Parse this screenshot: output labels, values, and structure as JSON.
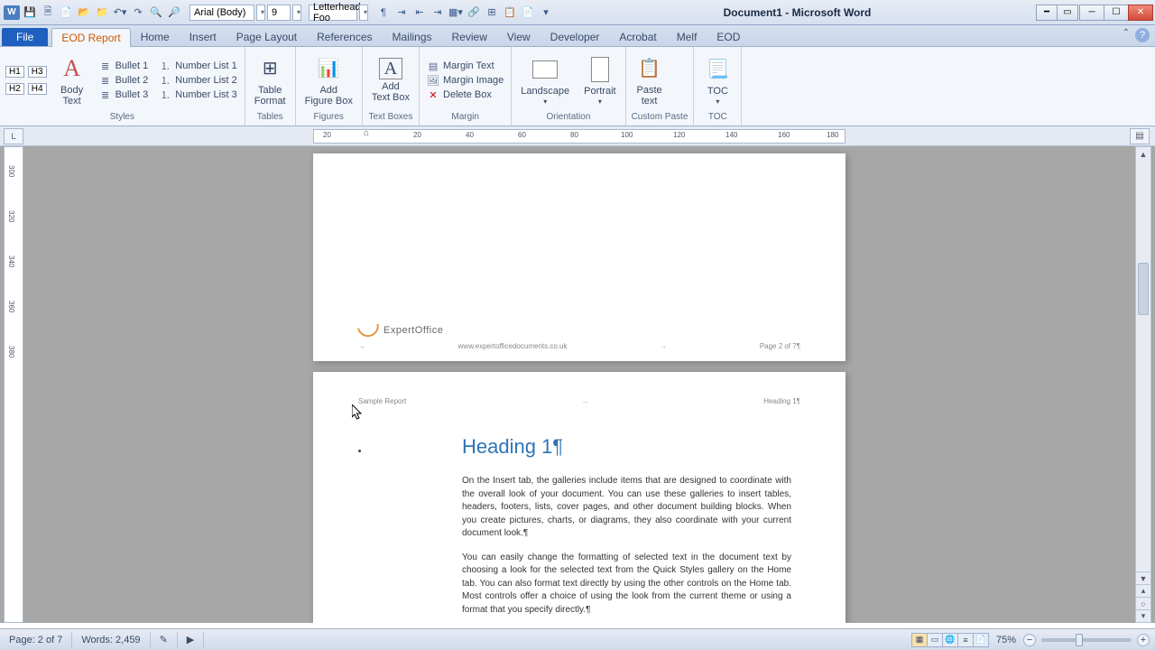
{
  "app": {
    "title": "Document1 - Microsoft Word"
  },
  "qat": {
    "font_name": "Arial (Body)",
    "font_size": "9",
    "quick_style": "Letterhead Foo"
  },
  "tabs": {
    "file": "File",
    "items": [
      "EOD Report",
      "Home",
      "Insert",
      "Page Layout",
      "References",
      "Mailings",
      "Review",
      "View",
      "Developer",
      "Acrobat",
      "Melf",
      "EOD"
    ],
    "active_index": 0
  },
  "ribbon": {
    "styles": {
      "label": "Styles",
      "h1": "H1",
      "h2": "H2",
      "h3": "H3",
      "h4": "H4",
      "body_text": "Body\nText",
      "bullets": [
        "Bullet 1",
        "Bullet 2",
        "Bullet 3"
      ],
      "numbers": [
        "Number List 1",
        "Number List 2",
        "Number List 3"
      ]
    },
    "tables": {
      "label": "Tables",
      "btn": "Table\nFormat"
    },
    "figures": {
      "label": "Figures",
      "btn": "Add\nFigure Box"
    },
    "textboxes": {
      "label": "Text Boxes",
      "btn": "Add\nText Box"
    },
    "margin": {
      "label": "Margin",
      "text": "Margin Text",
      "image": "Margin Image",
      "delete": "Delete Box"
    },
    "orientation": {
      "label": "Orientation",
      "landscape": "Landscape",
      "portrait": "Portrait"
    },
    "custompaste": {
      "label": "Custom Paste",
      "btn": "Paste\ntext"
    },
    "toc": {
      "label": "TOC",
      "btn": "TOC"
    }
  },
  "ruler": {
    "h_marks": [
      "20",
      "20",
      "40",
      "60",
      "80",
      "100",
      "120",
      "140",
      "160",
      "180"
    ]
  },
  "vruler_marks": [
    "300",
    "320",
    "340",
    "360",
    "380"
  ],
  "document": {
    "page1_footer": {
      "logo_text": "ExpertOffice",
      "url": "www.expertofficedocuments.co.uk",
      "page": "Page 2 of 7¶"
    },
    "page2_header": {
      "left": "Sample Report",
      "right": "Heading 1¶"
    },
    "page2_body": {
      "heading": "Heading 1¶",
      "para1": "On the Insert tab, the galleries include items that are designed to coordinate with the overall look of your document. You can use these galleries to insert tables, headers, footers, lists, cover pages, and other document building blocks. When you create pictures, charts, or diagrams, they also coordinate with your current document look.¶",
      "para2": "You can easily change the formatting of selected text in the document text by choosing a look for the selected text from the Quick Styles gallery on the Home tab. You can also format text directly by using the other controls on the Home tab. Most controls offer a choice of using the look from the current theme or using a format that you specify directly.¶"
    }
  },
  "status": {
    "page": "Page: 2 of 7",
    "words": "Words: 2,459",
    "zoom": "75%"
  }
}
